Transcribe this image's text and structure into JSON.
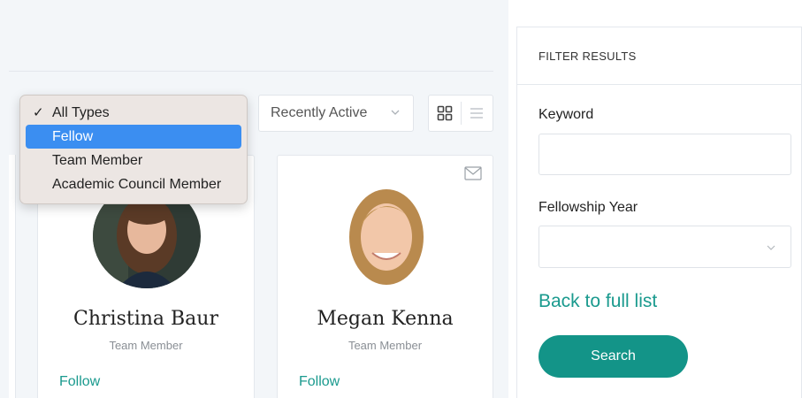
{
  "type_filter": {
    "options": [
      {
        "label": "All Types",
        "checked": true
      },
      {
        "label": "Fellow",
        "highlighted": true
      },
      {
        "label": "Team Member"
      },
      {
        "label": "Academic Council Member"
      }
    ]
  },
  "sort": {
    "selected": "Recently Active"
  },
  "view_toggle": {
    "grid_icon": "grid-icon",
    "list_icon": "list-icon"
  },
  "members": [
    {
      "name": "Christina Baur",
      "role": "Team Member",
      "follow_label": "Follow"
    },
    {
      "name": "Megan Kenna",
      "role": "Team Member",
      "follow_label": "Follow",
      "mail_icon": "mail-icon"
    }
  ],
  "filter": {
    "title": "FILTER RESULTS",
    "keyword_label": "Keyword",
    "keyword_value": "",
    "year_label": "Fellowship Year",
    "year_value": "",
    "back_link": "Back to full list",
    "search_label": "Search"
  },
  "colors": {
    "accent": "#139488",
    "link": "#1a9a8e",
    "menu_highlight": "#3b8ef1"
  }
}
